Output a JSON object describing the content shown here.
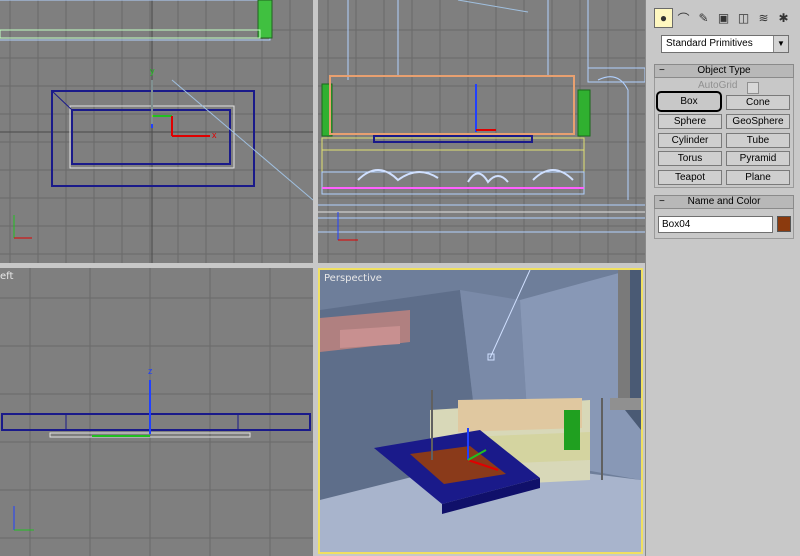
{
  "viewports": {
    "top_left": {
      "label": ""
    },
    "front": {
      "label": ""
    },
    "left": {
      "label": "eft"
    },
    "perspective": {
      "label": "Perspective"
    }
  },
  "axes": {
    "x": "x",
    "y": "y",
    "z": "z"
  },
  "panel": {
    "tabs": [
      {
        "icon": "sphere-icon",
        "glyph": "●",
        "active": true
      },
      {
        "icon": "shapes-icon",
        "glyph": "⌒"
      },
      {
        "icon": "lights-icon",
        "glyph": "✎"
      },
      {
        "icon": "cameras-icon",
        "glyph": "▣"
      },
      {
        "icon": "helpers-icon",
        "glyph": "◫"
      },
      {
        "icon": "spacewarps-icon",
        "glyph": "≋"
      },
      {
        "icon": "systems-icon",
        "glyph": "✱"
      }
    ],
    "category_dropdown": "Standard Primitives",
    "object_type": {
      "header": "Object Type",
      "minus": "−",
      "autogrid_label": "AutoGrid",
      "buttons": [
        "Box",
        "Cone",
        "Sphere",
        "GeoSphere",
        "Cylinder",
        "Tube",
        "Torus",
        "Pyramid",
        "Teapot",
        "Plane"
      ],
      "selected": "Box"
    },
    "name_and_color": {
      "header": "Name and Color",
      "minus": "−",
      "name_value": "Box04",
      "color": "#8b3a0e"
    }
  },
  "colors": {
    "viewport_bg": "#7f7f7f",
    "grid": "#6a6a6a",
    "active_border": "#f0e060",
    "selection_blue": "#1a1a8a",
    "panel_bg": "#c8c8c8"
  }
}
